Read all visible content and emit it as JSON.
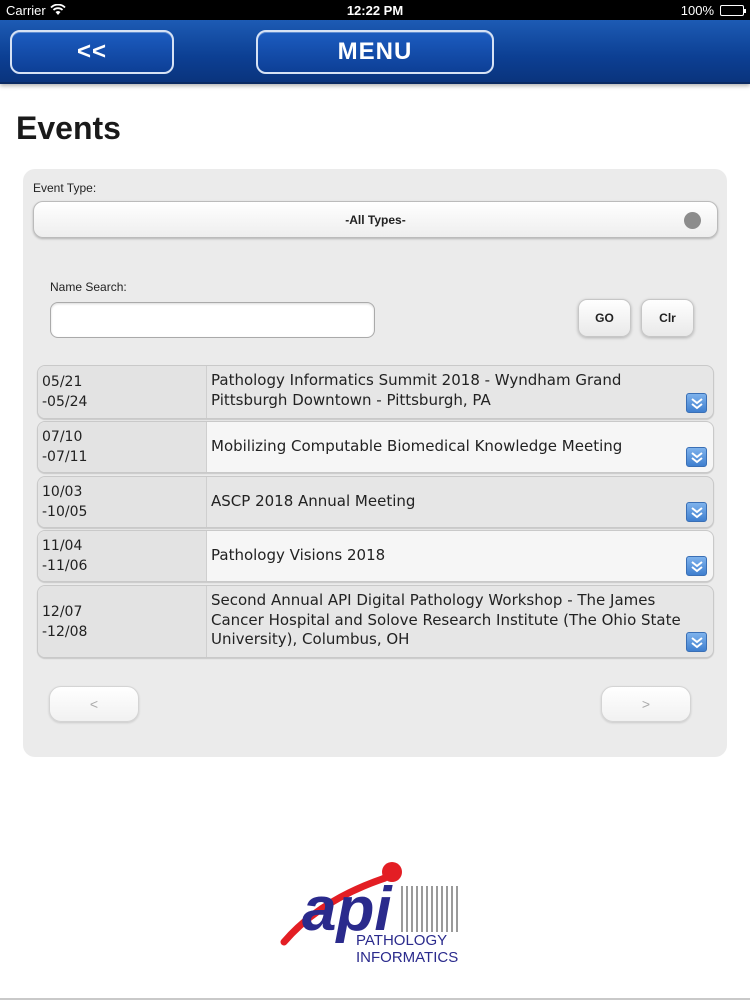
{
  "status_bar": {
    "carrier": "Carrier",
    "time": "12:22 PM",
    "battery": "100%"
  },
  "nav": {
    "back_label": "<<",
    "menu_label": "MENU"
  },
  "page": {
    "title": "Events"
  },
  "filters": {
    "event_type_label": "Event Type:",
    "event_type_value": "-All Types-",
    "name_search_label": "Name Search:",
    "name_search_value": "",
    "go_label": "GO",
    "clear_label": "Clr"
  },
  "events": [
    {
      "date_start": "05/21",
      "date_end": "-05/24",
      "title": "Pathology Informatics Summit 2018 - Wyndham Grand Pittsburgh Downtown - Pittsburgh, PA"
    },
    {
      "date_start": "07/10",
      "date_end": "-07/11",
      "title": "Mobilizing Computable Biomedical Knowledge Meeting"
    },
    {
      "date_start": "10/03",
      "date_end": "-10/05",
      "title": "ASCP 2018 Annual Meeting"
    },
    {
      "date_start": "11/04",
      "date_end": "-11/06",
      "title": "Pathology Visions 2018"
    },
    {
      "date_start": "12/07",
      "date_end": "-12/08",
      "title": "Second Annual API Digital Pathology Workshop - The James Cancer Hospital and Solove Research Institute (The Ohio State University), Columbus, OH"
    }
  ],
  "pagination": {
    "prev_label": "<",
    "next_label": ">"
  },
  "logo": {
    "word": "api",
    "line1": "PATHOLOGY",
    "line2": "INFORMATICS"
  },
  "colors": {
    "nav_blue": "#0c3f93",
    "logo_red": "#e31e24",
    "logo_blue": "#2a2a8c"
  }
}
